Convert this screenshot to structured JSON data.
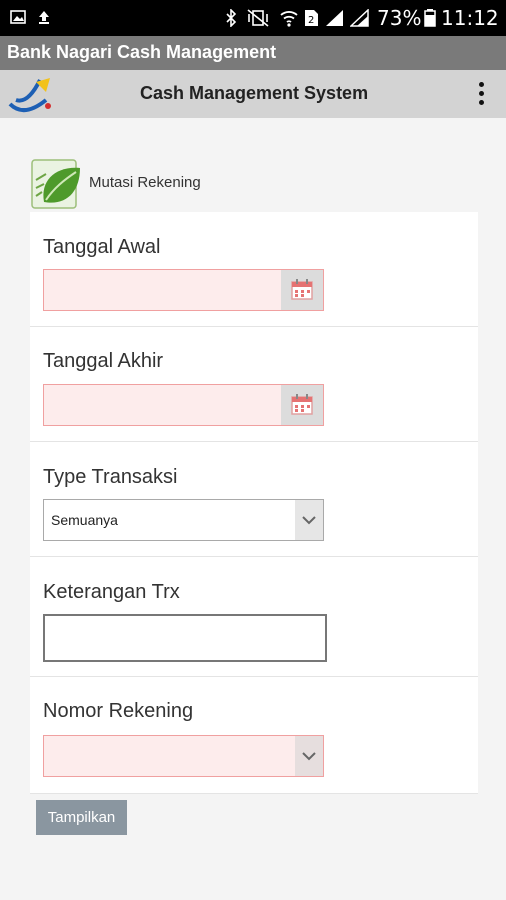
{
  "status_bar": {
    "battery": "73%",
    "time": "11:12"
  },
  "app": {
    "title": "Bank Nagari Cash Management"
  },
  "toolbar": {
    "title": "Cash Management System"
  },
  "section": {
    "label": "Mutasi Rekening"
  },
  "form": {
    "start_date": {
      "label": "Tanggal Awal",
      "value": ""
    },
    "end_date": {
      "label": "Tanggal Akhir",
      "value": ""
    },
    "trx_type": {
      "label": "Type Transaksi",
      "selected": "Semuanya"
    },
    "trx_note": {
      "label": "Keterangan Trx",
      "value": ""
    },
    "account_no": {
      "label": "Nomor Rekening",
      "selected": ""
    },
    "submit_label": "Tampilkan"
  },
  "colors": {
    "invalid_bg": "#fdecec",
    "invalid_border": "#f0a0a0",
    "button": "#8a96a0"
  }
}
